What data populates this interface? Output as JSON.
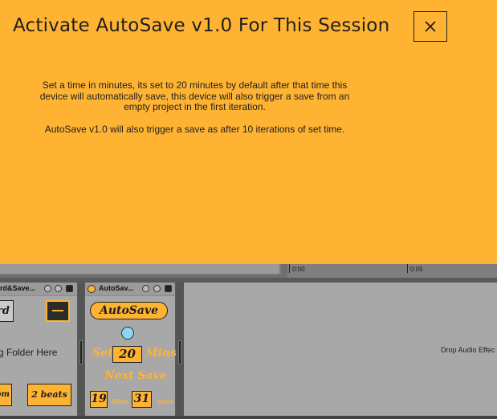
{
  "dialog": {
    "title": "Activate AutoSave v1.0 For This Session",
    "description_1": "Set a time in minutes, its set to 20 minutes by default after that time this device will automatically save, this device will also trigger a save from an empty project in the first iteration.",
    "description_2": "AutoSave v1.0 will also trigger a save as after 10 iterations of set time.",
    "close_icon": "close-icon"
  },
  "timeline": {
    "tick_1": "0:00",
    "tick_2": "0:05"
  },
  "devices": {
    "record_device": {
      "name": "rd&Save...",
      "record_label": "rd",
      "drop_text": "g Folder Here",
      "zoom_label": "om",
      "beats_label": "2 beats"
    },
    "autosave_device": {
      "name": "AutoSav...",
      "button_label": "AutoSave",
      "set_label": "Set",
      "set_value": "20",
      "mins_label": "Mins",
      "next_save_label": "Next Save",
      "next_mins_value": "19",
      "next_mins_unit": "Mins",
      "next_secs_value": "31",
      "next_secs_unit": "Secs"
    },
    "drop_zone": {
      "hint": "Drop Audio Effec"
    }
  },
  "colors": {
    "accent": "#ffb333",
    "led": "#8fd3f5"
  }
}
